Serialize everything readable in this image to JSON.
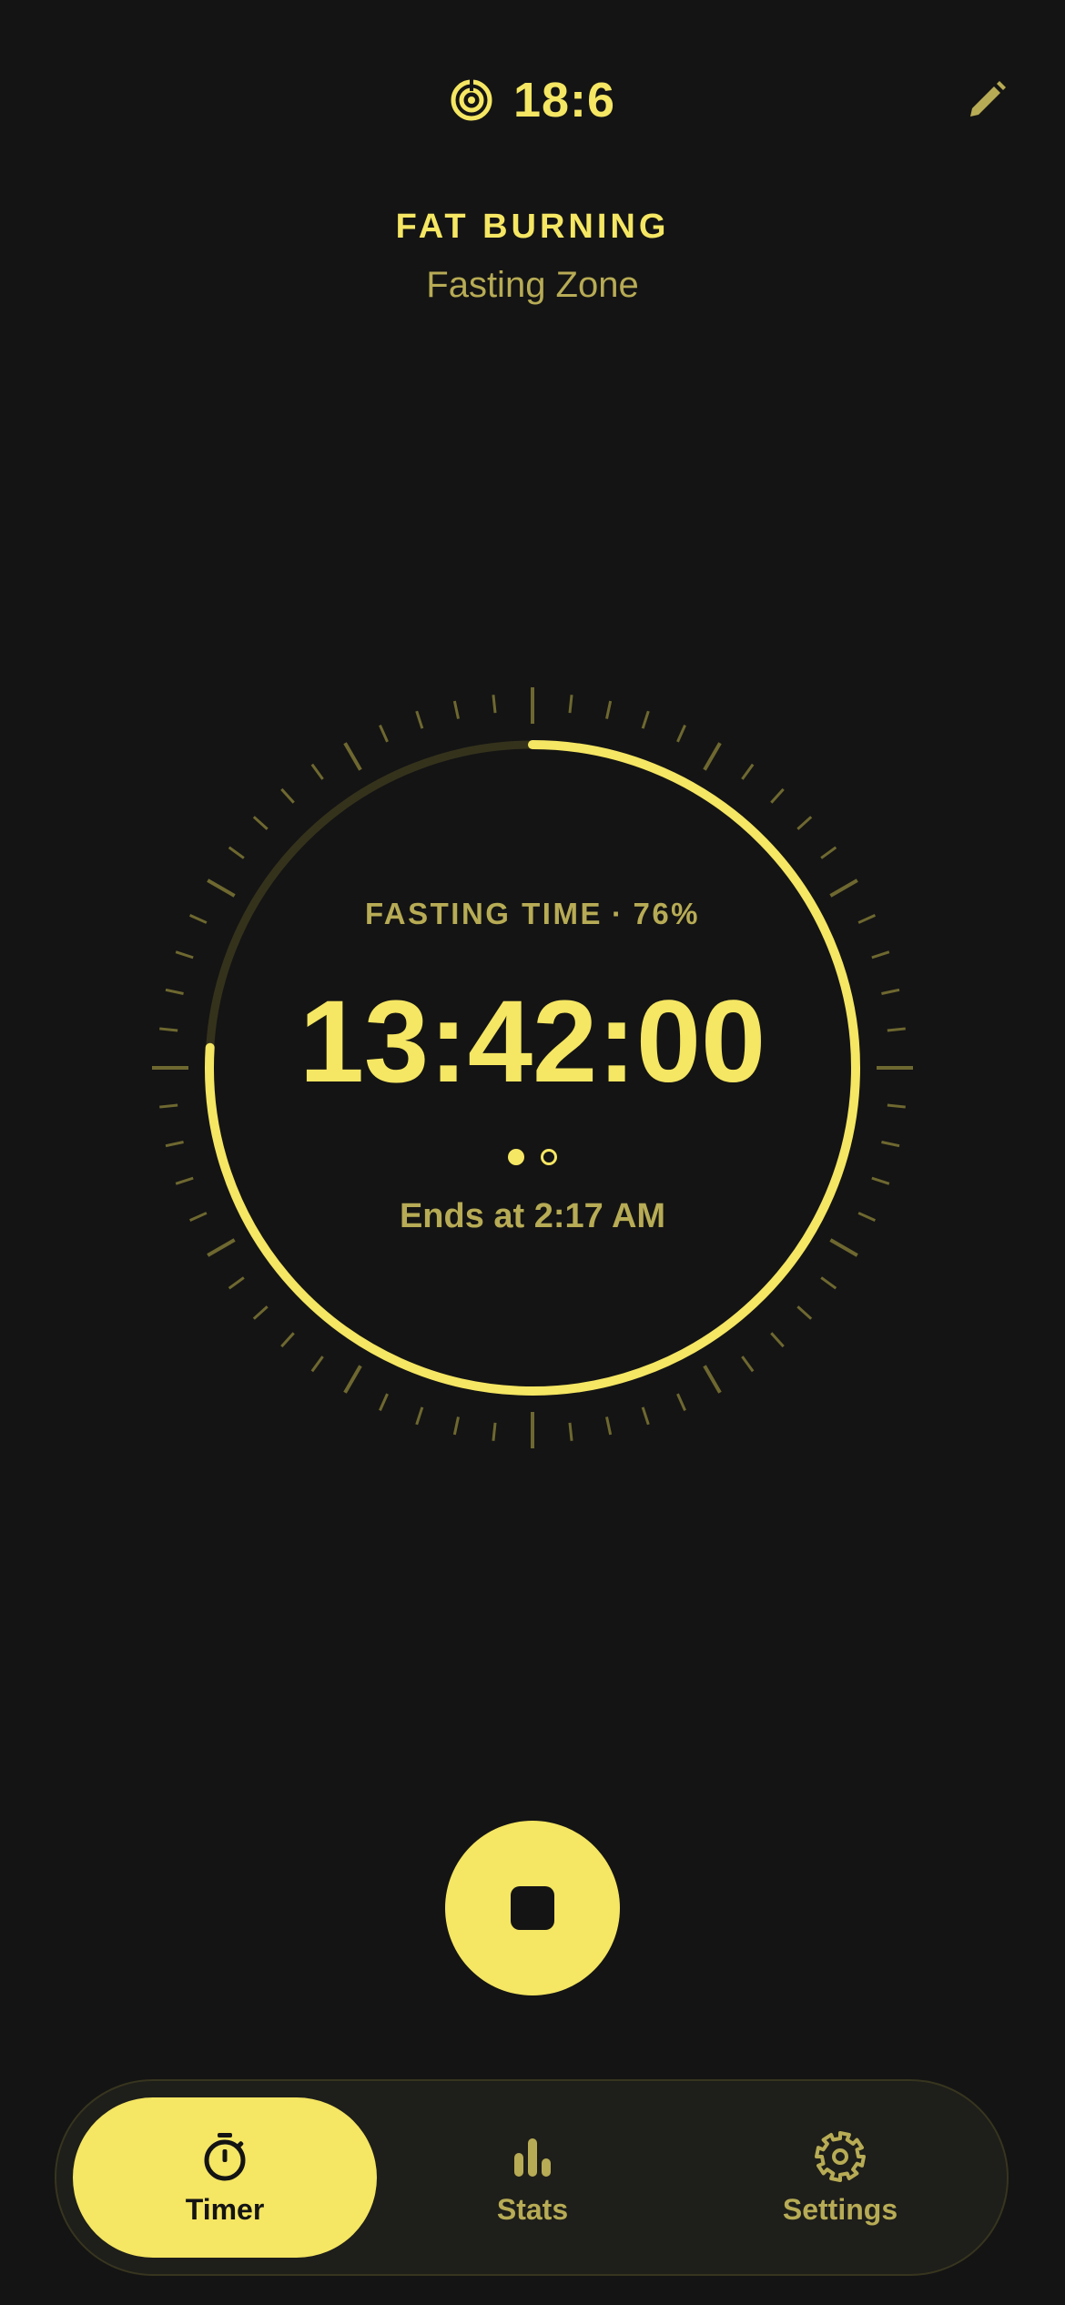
{
  "header": {
    "plan_label": "18:6",
    "plan_icon": "target-icon",
    "edit_icon": "pencil-icon"
  },
  "zone": {
    "title": "FAT BURNING",
    "subtitle": "Fasting Zone"
  },
  "timer": {
    "label": "FASTING TIME",
    "separator": "·",
    "percent_text": "76%",
    "progress": 0.76,
    "elapsed": "13:42:00",
    "ends_text": "Ends at 2:17 AM",
    "pages": 2,
    "active_page": 0
  },
  "action": {
    "stop_icon": "stop-icon"
  },
  "nav": {
    "items": [
      {
        "label": "Timer",
        "icon": "stopwatch-icon",
        "active": true
      },
      {
        "label": "Stats",
        "icon": "bar-chart-icon",
        "active": false
      },
      {
        "label": "Settings",
        "icon": "gear-icon",
        "active": false
      }
    ]
  },
  "colors": {
    "background": "#141414",
    "accent": "#F5E663",
    "muted": "#B7AB55",
    "track": "#35321C",
    "nav_bg": "#1E1E1A"
  }
}
